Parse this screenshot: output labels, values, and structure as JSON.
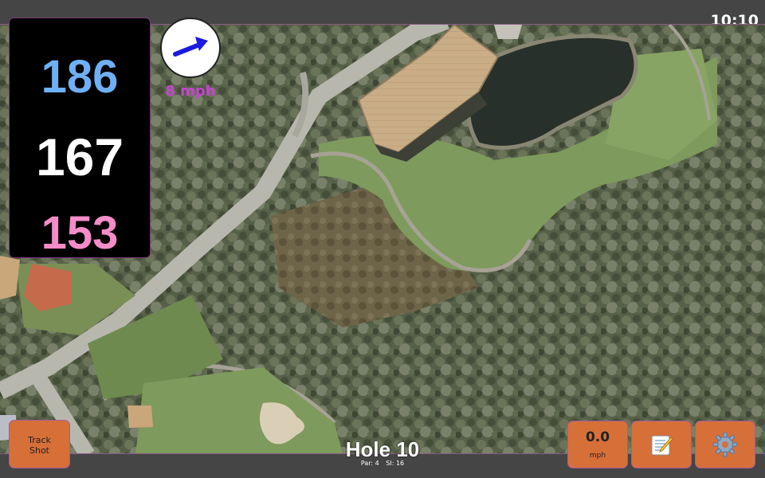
{
  "status_bar": {
    "time": "10:10"
  },
  "distances": {
    "back": "186",
    "middle": "167",
    "front": "153"
  },
  "wind": {
    "speed": "8 mph",
    "direction_icon": "arrow-right-icon"
  },
  "hole": {
    "title": "Hole 10",
    "par": "Par: 4",
    "stroke_index": "SI: 16"
  },
  "buttons": {
    "track_shot_line1": "Track",
    "track_shot_line2": "Shot",
    "speed_value": "0.0",
    "speed_unit": "mph",
    "notes_icon": "notepad-icon",
    "settings_icon": "gear-icon"
  },
  "colors": {
    "back": "#6fb0f4",
    "middle": "#ffffff",
    "front": "#f48cc8",
    "accent_button": "#d76f39",
    "wind_text": "#c445cf"
  }
}
